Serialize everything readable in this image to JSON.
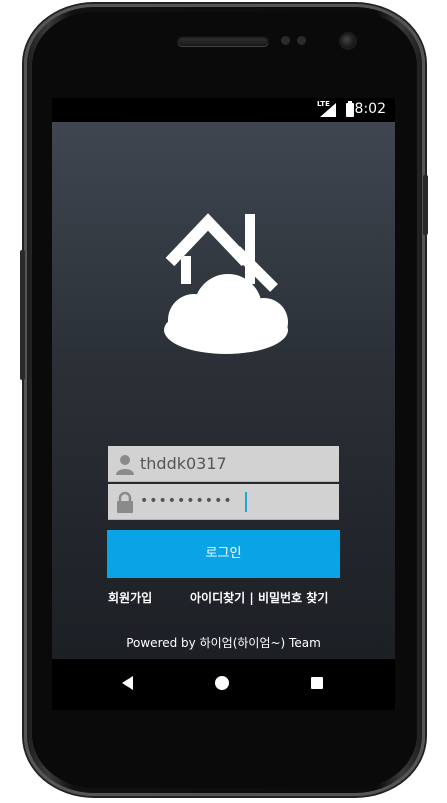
{
  "status_bar": {
    "time": "8:02",
    "network": "LTE"
  },
  "login_form": {
    "username_value": "thddk0317",
    "password_value": "••••••••••"
  },
  "buttons": {
    "login_label": "로그인"
  },
  "links": {
    "signup": "회원가입",
    "find_id_and_password": "아이디찾기 | 비밀번호 찾기"
  },
  "footer": {
    "powered_by": "Powered by 하이엄(하이엄~) Team"
  },
  "colors": {
    "accent": "#0aa3e6",
    "background_top": "#3f4650",
    "background_bottom": "#1c1f24",
    "field_background": "#d2d2d2"
  },
  "icons": {
    "logo": "house-cloud-icon",
    "username": "user-icon",
    "password": "lock-icon",
    "nav_back": "back-triangle-icon",
    "nav_home": "home-circle-icon",
    "nav_recent": "recent-square-icon"
  }
}
